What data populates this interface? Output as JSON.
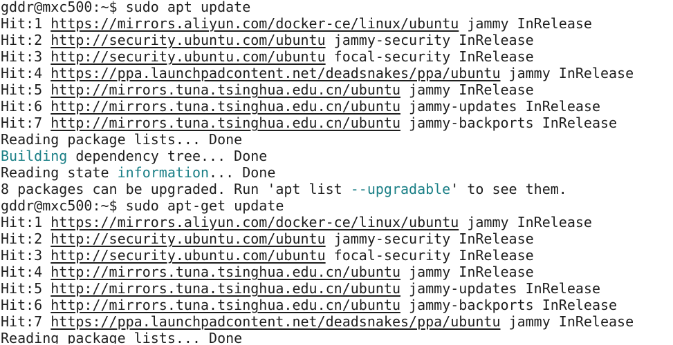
{
  "terminal": {
    "colors": {
      "background": "#ffffff",
      "text": "#1e1e1e",
      "highlight": "#1a7f86"
    },
    "lines": [
      {
        "type": "prompt",
        "prompt": "gddr@mxc500:~$",
        "command": " sudo apt update"
      },
      {
        "type": "hit",
        "prefix": "Hit:1",
        "url": "https://mirrors.aliyun.com/docker-ce/linux/ubuntu",
        "suffix": " jammy InRelease"
      },
      {
        "type": "hit",
        "prefix": "Hit:2",
        "url": "http://security.ubuntu.com/ubuntu",
        "suffix": " jammy-security InRelease"
      },
      {
        "type": "hit",
        "prefix": "Hit:3",
        "url": "http://security.ubuntu.com/ubuntu",
        "suffix": " focal-security InRelease"
      },
      {
        "type": "hit",
        "prefix": "Hit:4",
        "url": "https://ppa.launchpadcontent.net/deadsnakes/ppa/ubuntu",
        "suffix": " jammy InRelease"
      },
      {
        "type": "hit",
        "prefix": "Hit:5",
        "url": "http://mirrors.tuna.tsinghua.edu.cn/ubuntu",
        "suffix": " jammy InRelease"
      },
      {
        "type": "hit",
        "prefix": "Hit:6",
        "url": "http://mirrors.tuna.tsinghua.edu.cn/ubuntu",
        "suffix": " jammy-updates InRelease"
      },
      {
        "type": "hit",
        "prefix": "Hit:7",
        "url": "http://mirrors.tuna.tsinghua.edu.cn/ubuntu",
        "suffix": " jammy-backports InRelease"
      },
      {
        "type": "plain",
        "text": "Reading package lists... Done"
      },
      {
        "type": "building",
        "highlight": "Building",
        "rest": " dependency tree... Done"
      },
      {
        "type": "reading-state",
        "before": "Reading state ",
        "highlight": "information",
        "after": "... Done"
      },
      {
        "type": "upgrade",
        "before": "8 packages can be upgraded. Run ",
        "quoted": "'apt list --upgradable'",
        "after": " to see them."
      },
      {
        "type": "prompt",
        "prompt": "gddr@mxc500:~$",
        "command": " sudo apt-get update"
      },
      {
        "type": "hit",
        "prefix": "Hit:1",
        "url": "https://mirrors.aliyun.com/docker-ce/linux/ubuntu",
        "suffix": " jammy InRelease"
      },
      {
        "type": "hit",
        "prefix": "Hit:2",
        "url": "http://security.ubuntu.com/ubuntu",
        "suffix": " jammy-security InRelease"
      },
      {
        "type": "hit",
        "prefix": "Hit:3",
        "url": "http://security.ubuntu.com/ubuntu",
        "suffix": " focal-security InRelease"
      },
      {
        "type": "hit",
        "prefix": "Hit:4",
        "url": "http://mirrors.tuna.tsinghua.edu.cn/ubuntu",
        "suffix": " jammy InRelease"
      },
      {
        "type": "hit",
        "prefix": "Hit:5",
        "url": "http://mirrors.tuna.tsinghua.edu.cn/ubuntu",
        "suffix": " jammy-updates InRelease"
      },
      {
        "type": "hit",
        "prefix": "Hit:6",
        "url": "http://mirrors.tuna.tsinghua.edu.cn/ubuntu",
        "suffix": " jammy-backports InRelease"
      },
      {
        "type": "hit",
        "prefix": "Hit:7",
        "url": "https://ppa.launchpadcontent.net/deadsnakes/ppa/ubuntu",
        "suffix": " jammy InRelease"
      },
      {
        "type": "plain",
        "text": "Reading package lists... Done"
      }
    ]
  }
}
